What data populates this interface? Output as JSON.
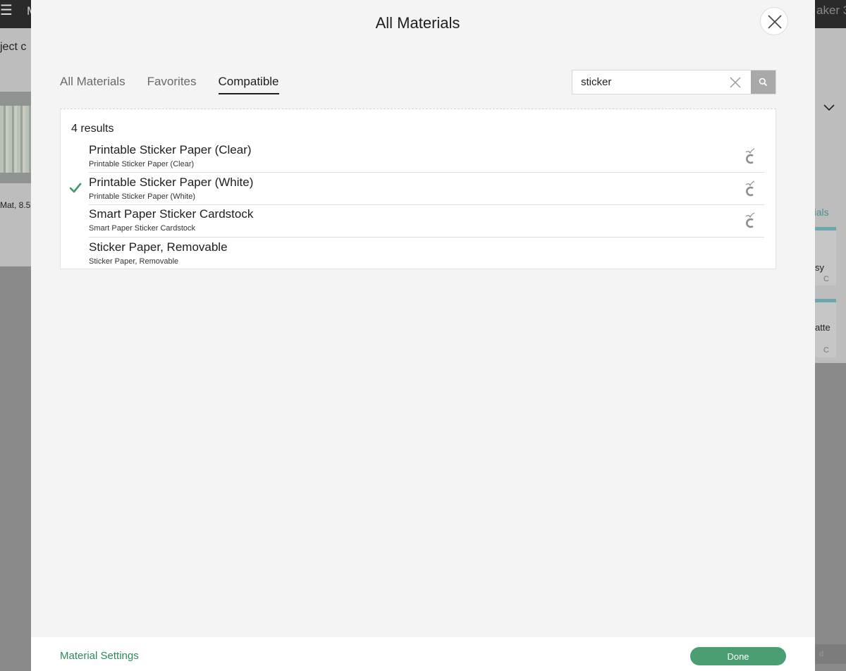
{
  "background": {
    "top_left_text": "M",
    "top_right_text": "aker 3",
    "left_title": "ject c",
    "left_mat": "Mat, 8.5",
    "right_link": "rials",
    "right_card1_text": "sy",
    "right_card1_code": "C",
    "right_card2_text": "atte",
    "right_card2_code": "C",
    "bottom_right_btn": "d"
  },
  "modal": {
    "title": "All Materials",
    "tabs": [
      {
        "label": "All Materials",
        "active": false
      },
      {
        "label": "Favorites",
        "active": false
      },
      {
        "label": "Compatible",
        "active": true
      }
    ],
    "search": {
      "value": "sticker",
      "placeholder": ""
    },
    "results": {
      "count_label": "4 results",
      "items": [
        {
          "title": "Printable Sticker Paper (Clear)",
          "subtitle": "Printable Sticker Paper (Clear)",
          "selected": false,
          "compatible_icon": true
        },
        {
          "title": "Printable Sticker Paper (White)",
          "subtitle": "Printable Sticker Paper (White)",
          "selected": true,
          "compatible_icon": true
        },
        {
          "title": "Smart Paper Sticker Cardstock",
          "subtitle": "Smart Paper Sticker Cardstock",
          "selected": false,
          "compatible_icon": true
        },
        {
          "title": "Sticker Paper, Removable",
          "subtitle": "Sticker Paper, Removable",
          "selected": false,
          "compatible_icon": false
        }
      ]
    },
    "footer": {
      "settings_label": "Material Settings",
      "done_label": "Done"
    }
  },
  "colors": {
    "accent_green": "#4a9e72",
    "link_green": "#2e8a5a",
    "check_green": "#3f9a6b"
  }
}
